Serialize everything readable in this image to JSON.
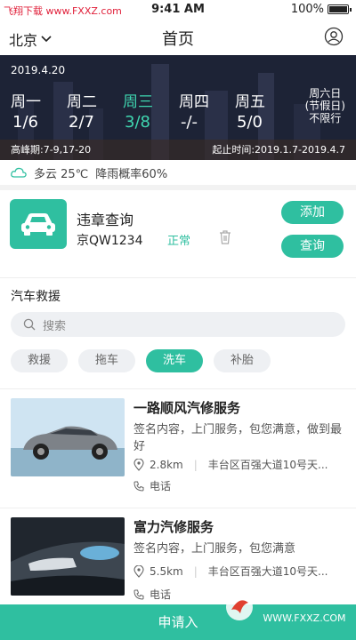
{
  "status": {
    "left": "飞翔下载 www.FXXZ.com",
    "time": "9:41 AM",
    "battery": "100%"
  },
  "nav": {
    "city": "北京",
    "title": "首页"
  },
  "banner": {
    "date": "2019.4.20",
    "days": [
      {
        "name": "周一",
        "num": "1/6"
      },
      {
        "name": "周二",
        "num": "2/7"
      },
      {
        "name": "周三",
        "num": "3/8"
      },
      {
        "name": "周四",
        "num": "-/-"
      },
      {
        "name": "周五",
        "num": "5/0"
      }
    ],
    "weekend": [
      "周六日",
      "(节假日)",
      "不限行"
    ],
    "peak": "高峰期:7-9,17-20",
    "period": "起止时间:2019.1.7-2019.4.7"
  },
  "weather": {
    "text": "多云 25℃",
    "rain": "降雨概率60%"
  },
  "violation": {
    "title": "违章查询",
    "plate": "京QW1234",
    "status": "正常",
    "add_label": "添加",
    "query_label": "查询"
  },
  "rescue": {
    "title": "汽车救援",
    "search_placeholder": "搜索",
    "tags": [
      "救援",
      "拖车",
      "洗车",
      "补胎"
    ]
  },
  "shops": [
    {
      "name": "一路顺风汽修服务",
      "desc": "签名内容，上门服务，包您满意，做到最好",
      "distance": "2.8km",
      "address": "丰台区百强大道10号天...",
      "phone": "电话"
    },
    {
      "name": "富力汽修服务",
      "desc": "签名内容，上门服务，包您满意",
      "distance": "5.5km",
      "address": "丰台区百强大道10号天...",
      "phone": "电话"
    }
  ],
  "bottom": {
    "label": "申请入"
  },
  "watermark": {
    "big": "飞翔下载",
    "small": "WWW.FXXZ.COM"
  },
  "colors": {
    "accent": "#2fbfa0",
    "active_day": "#3fd6b0"
  }
}
